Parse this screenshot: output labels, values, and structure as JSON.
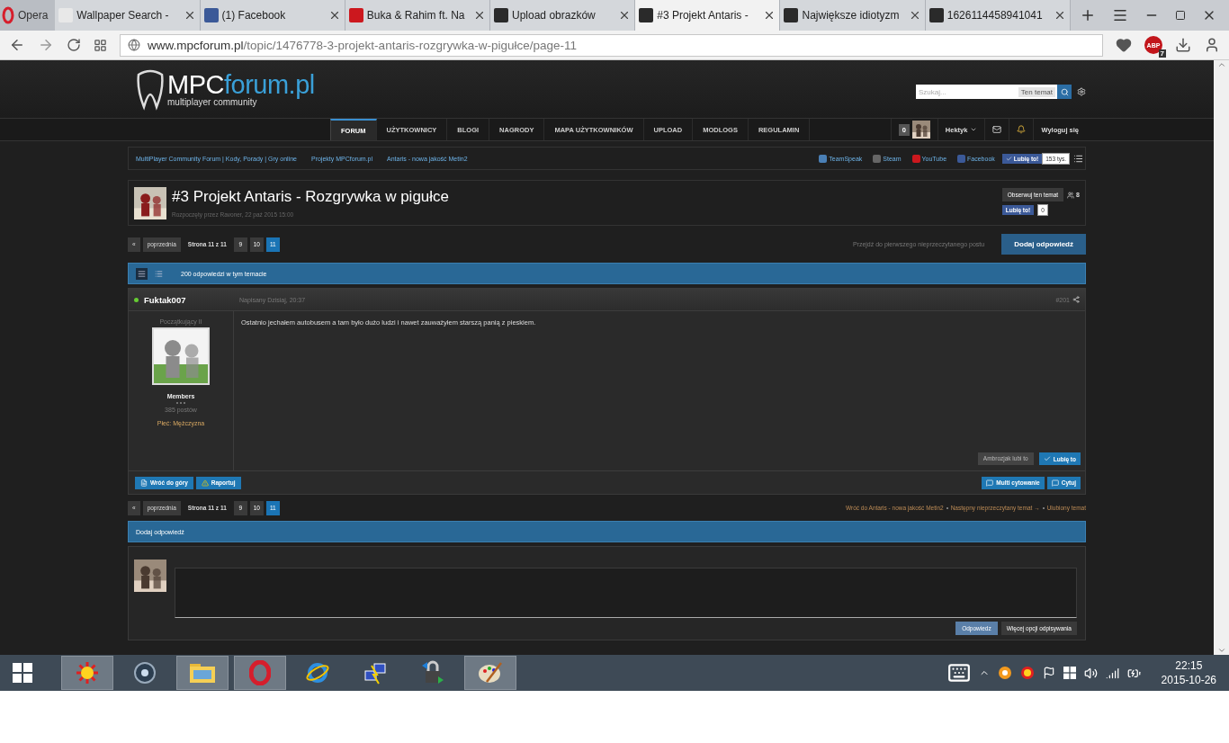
{
  "browser": {
    "menu_label": "Opera",
    "tabs": [
      {
        "title": "Wallpaper Search -",
        "kind": "wallpaper",
        "selected": false
      },
      {
        "title": "(1) Facebook",
        "kind": "facebook",
        "selected": false
      },
      {
        "title": "Buka & Rahim ft. Na",
        "kind": "youtube",
        "selected": false
      },
      {
        "title": "Upload obrazków",
        "kind": "mpc",
        "selected": false
      },
      {
        "title": "#3 Projekt Antaris -",
        "kind": "mpc",
        "selected": true
      },
      {
        "title": "Największe idiotyzm",
        "kind": "mpc",
        "selected": false
      },
      {
        "title": "1626114458941041",
        "kind": "mpc",
        "selected": false
      }
    ],
    "url_host": "www.mpcforum.pl",
    "url_path": "/topic/1476778-3-projekt-antaris-rozgrywka-w-pigułce/page-11",
    "adblock_label": "ABP",
    "adblock_badge": "7"
  },
  "site": {
    "logo_main": "MPC",
    "logo_accent": "forum.pl",
    "tagline": "multiplayer community",
    "search": {
      "placeholder": "Szukaj...",
      "scope": "Ten temat"
    },
    "nav": [
      {
        "label": "FORUM",
        "selected": true
      },
      {
        "label": "UŻYTKOWNICY",
        "selected": false
      },
      {
        "label": "BLOGI",
        "selected": false
      },
      {
        "label": "NAGRODY",
        "selected": false
      },
      {
        "label": "MAPA UŻYTKOWNIKÓW",
        "selected": false
      },
      {
        "label": "UPLOAD",
        "selected": false
      },
      {
        "label": "MODLOGS",
        "selected": false
      },
      {
        "label": "REGULAMIN",
        "selected": false
      }
    ],
    "user": {
      "count": "0",
      "name": "Hektyk",
      "logout": "Wyloguj się"
    },
    "breadcrumbs": [
      "MultiPlayer Community Forum | Kody, Porady | Gry online",
      "Projekty MPCforum.pl",
      "Antaris - nowa jakość Metin2"
    ],
    "social": [
      {
        "label": "TeamSpeak",
        "kind": "teamspeak"
      },
      {
        "label": "Steam",
        "kind": "steam"
      },
      {
        "label": "YouTube",
        "kind": "youtube"
      },
      {
        "label": "Facebook",
        "kind": "facebook"
      }
    ],
    "like": {
      "label": "Lubię to!",
      "count": "153 tys."
    }
  },
  "topic": {
    "title": "#3 Projekt Antaris - Rozgrywka w pigułce",
    "meta": "Rozpoczęty przez Ravoner, 22 paź 2015 15:00",
    "follow": "Obserwuj ten temat",
    "followers": "8",
    "like_label": "Lubię to!",
    "like_count": "0"
  },
  "pagination_top": {
    "prev_symbol": "«",
    "prev": "poprzednia",
    "info": "Strona 11 z 11",
    "pages": [
      {
        "label": "9",
        "selected": false
      },
      {
        "label": "10",
        "selected": false
      },
      {
        "label": "11",
        "selected": true
      }
    ]
  },
  "unread_link": "Przejdź do pierwszego nieprzeczytanego postu",
  "add_reply": "Dodaj odpowiedź",
  "replies_bar": {
    "text": "200 odpowiedzi w tym temacie",
    "views": [
      {
        "kind": "full",
        "selected": true
      },
      {
        "kind": "compact",
        "selected": false
      }
    ]
  },
  "post": {
    "author": "Fuktak007",
    "online": true,
    "date": "Napisany Dzisiaj, 20:37",
    "number": "#201",
    "rank": "Początkujący II",
    "group": "Members",
    "posts": "385 postów",
    "gender_label": "Płeć:",
    "gender": "Mężczyzna",
    "text": "Ostatnio jechałem autobusem a tam było dużo ludzi i nawet zauważyłem starszą panią z pieskiem.",
    "liked_by": "Ambrozjak lubi to",
    "like": "Lubię to",
    "back_top": "Wróć do góry",
    "report": "Raportuj",
    "multiquote": "Multi cytowanie",
    "quote": "Cytuj"
  },
  "pagination_bottom": {
    "prev_symbol": "«",
    "prev": "poprzednia",
    "info": "Strona 11 z 11",
    "pages": [
      {
        "label": "9",
        "selected": false
      },
      {
        "label": "10",
        "selected": false
      },
      {
        "label": "11",
        "selected": true
      }
    ]
  },
  "bottom_links": [
    "Wróć do Antaris - nowa jakość Metin2",
    "Następny nieprzeczytany temat →",
    "Ulubiony temat"
  ],
  "reply": {
    "title": "Dodaj odpowiedź",
    "submit": "Odpowiedz",
    "more": "Więcej opcji odpisywania"
  },
  "taskbar": {
    "apps": [
      {
        "kind": "sun",
        "active": true
      },
      {
        "kind": "disc",
        "active": false
      },
      {
        "kind": "folder",
        "active": true
      },
      {
        "kind": "opera",
        "active": true
      },
      {
        "kind": "ie",
        "active": false
      },
      {
        "kind": "network",
        "active": false
      },
      {
        "kind": "lock",
        "active": false
      },
      {
        "kind": "paint",
        "active": true
      }
    ],
    "time": "22:15",
    "date": "2015-10-26"
  }
}
